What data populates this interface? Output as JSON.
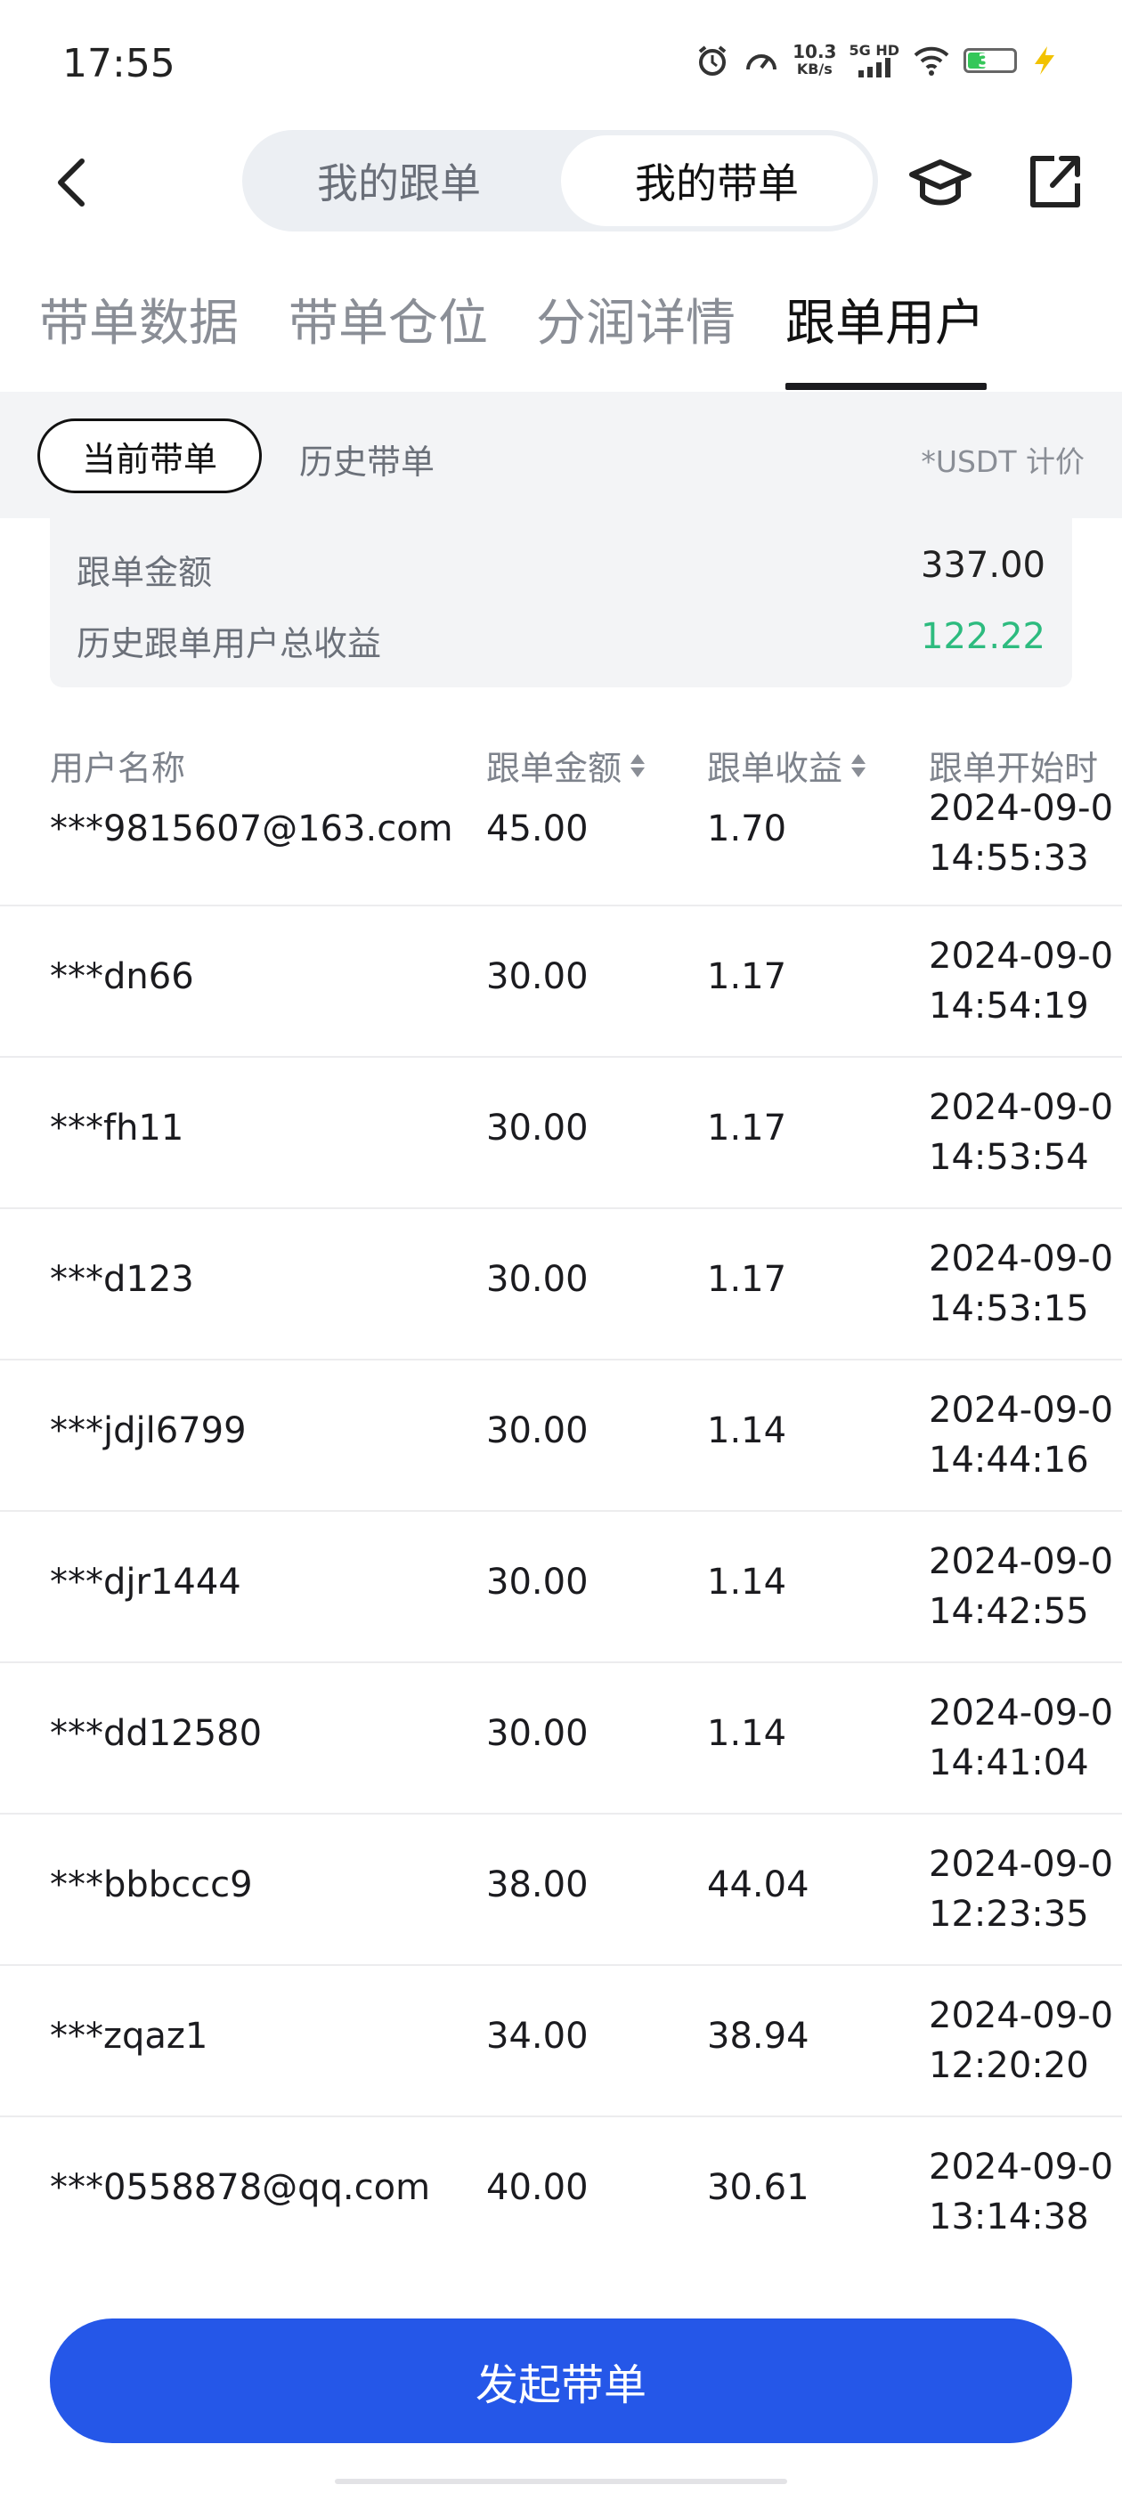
{
  "status_bar": {
    "time": "17:55",
    "speed_value": "10.3",
    "speed_unit": "KB/s",
    "network": "5G HD",
    "battery": "37"
  },
  "header": {
    "segment_left": "我的跟单",
    "segment_right": "我的带单",
    "icons": [
      "back-arrow-icon",
      "graduation-cap-icon",
      "share-icon"
    ]
  },
  "tabs": [
    {
      "label": "带单数据",
      "active": false
    },
    {
      "label": "带单仓位",
      "active": false
    },
    {
      "label": "分润详情",
      "active": false
    },
    {
      "label": "跟单用户",
      "active": true
    }
  ],
  "filter": {
    "current": "当前带单",
    "history": "历史带单",
    "note": "*USDT 计价"
  },
  "summary": {
    "amount_label": "跟单金额",
    "amount_value": "337.00",
    "profit_label": "历史跟单用户总收益",
    "profit_value": "122.22",
    "profit_color": "#2dbb7f"
  },
  "table": {
    "headers": [
      "用户名称",
      "跟单金额",
      "跟单收益",
      "跟单开始时"
    ],
    "rows": [
      {
        "user": "***9815607@163.com",
        "amount": "45.00",
        "profit": "1.70",
        "date": "2024-09-0",
        "time": "14:55:33"
      },
      {
        "user": "***dn66",
        "amount": "30.00",
        "profit": "1.17",
        "date": "2024-09-0",
        "time": "14:54:19"
      },
      {
        "user": "***fh11",
        "amount": "30.00",
        "profit": "1.17",
        "date": "2024-09-0",
        "time": "14:53:54"
      },
      {
        "user": "***d123",
        "amount": "30.00",
        "profit": "1.17",
        "date": "2024-09-0",
        "time": "14:53:15"
      },
      {
        "user": "***jdjl6799",
        "amount": "30.00",
        "profit": "1.14",
        "date": "2024-09-0",
        "time": "14:44:16"
      },
      {
        "user": "***djr1444",
        "amount": "30.00",
        "profit": "1.14",
        "date": "2024-09-0",
        "time": "14:42:55"
      },
      {
        "user": "***dd12580",
        "amount": "30.00",
        "profit": "1.14",
        "date": "2024-09-0",
        "time": "14:41:04"
      },
      {
        "user": "***bbbccc9",
        "amount": "38.00",
        "profit": "44.04",
        "date": "2024-09-0",
        "time": "12:23:35"
      },
      {
        "user": "***zqaz1",
        "amount": "34.00",
        "profit": "38.94",
        "date": "2024-09-0",
        "time": "12:20:20"
      },
      {
        "user": "***0558878@qq.com",
        "amount": "40.00",
        "profit": "30.61",
        "date": "2024-09-0",
        "time": "13:14:38"
      }
    ]
  },
  "primary_button": "发起带单",
  "colors": {
    "accent": "#2557e8",
    "positive": "#2dbb7f"
  }
}
